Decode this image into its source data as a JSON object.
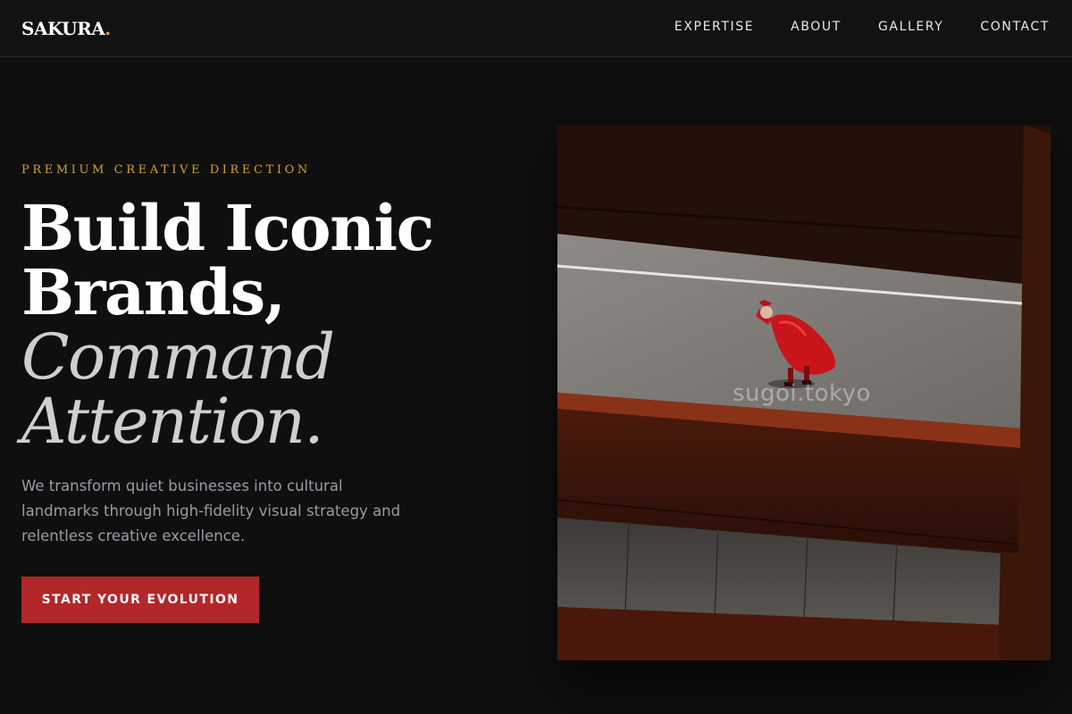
{
  "header": {
    "logo_text": "SAKURA",
    "logo_dot": ".",
    "nav": [
      {
        "label": "EXPERTISE"
      },
      {
        "label": "ABOUT"
      },
      {
        "label": "GALLERY"
      },
      {
        "label": "CONTACT"
      }
    ]
  },
  "hero": {
    "eyebrow": "PREMIUM CREATIVE DIRECTION",
    "headline": {
      "line1": "Build Iconic",
      "line2": "Brands,",
      "line3": "Command",
      "line4": "Attention."
    },
    "subcopy": "We transform quiet businesses into cultural landmarks through high-fidelity visual strategy and relentless creative excellence.",
    "cta_label": "START YOUR EVOLUTION",
    "image_watermark": "sugoi.tokyo"
  },
  "colors": {
    "background": "#0f0f10",
    "accent_gold": "#d0a229",
    "cta_red": "#b3262a",
    "body_text": "#9a9ca3"
  }
}
